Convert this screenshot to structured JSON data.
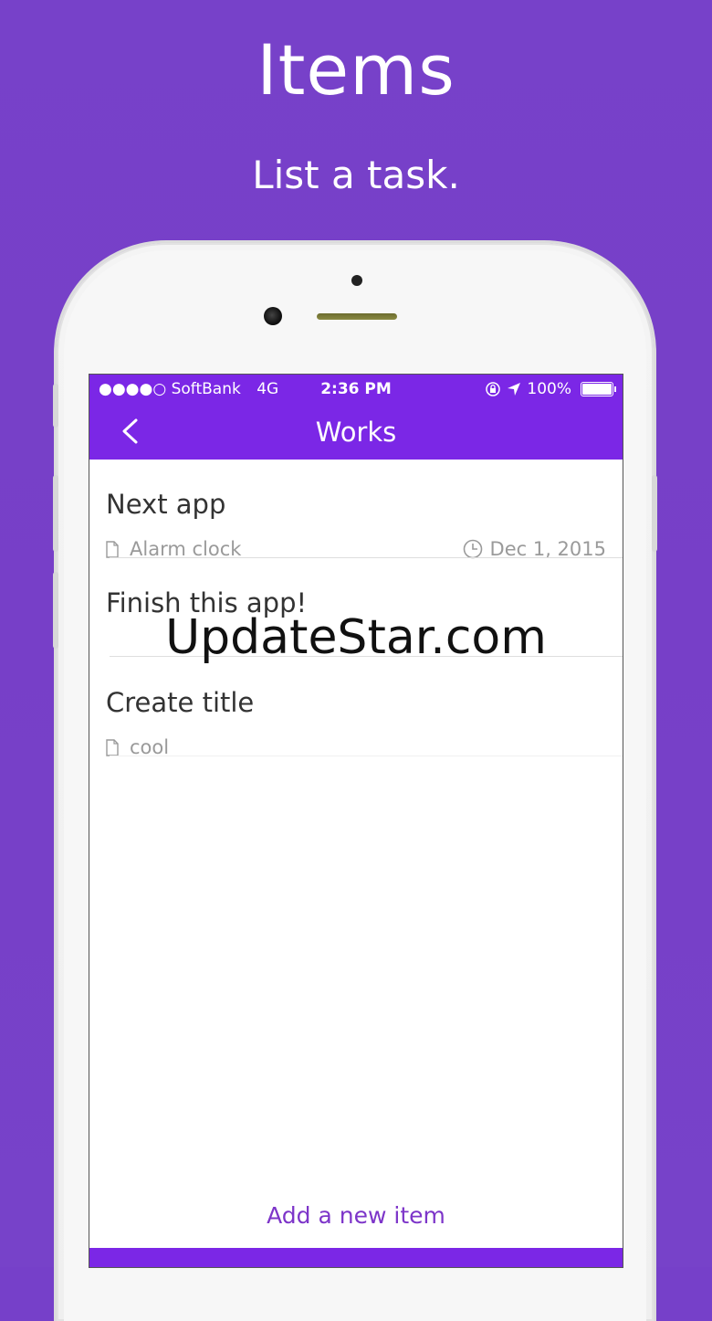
{
  "promo": {
    "headline": "Items",
    "subline": "List a task."
  },
  "status_bar": {
    "carrier": "●●●●○ SoftBank",
    "network": "4G",
    "time": "2:36 PM",
    "battery": "100%"
  },
  "nav": {
    "title": "Works",
    "back_icon": "chevron-left-icon"
  },
  "items": [
    {
      "title": "Next app",
      "note": "Alarm clock",
      "date": "Dec 1, 2015"
    },
    {
      "title": "Finish this app!",
      "note": "",
      "date": ""
    },
    {
      "title": "Create title",
      "note": "cool",
      "date": ""
    }
  ],
  "footer": {
    "add_label": "Add a new item"
  },
  "watermark": "UpdateStar.com",
  "colors": {
    "background": "#7640c9",
    "accent": "#7b27e6",
    "link": "#7d35c9"
  }
}
